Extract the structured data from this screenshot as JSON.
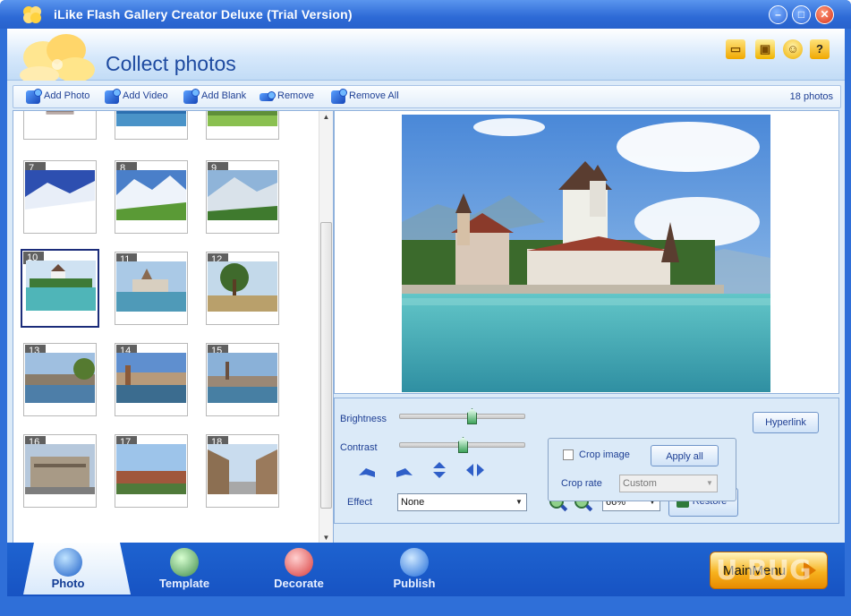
{
  "window": {
    "title": "iLike Flash Gallery Creator Deluxe (Trial Version)",
    "min_icon": "minimize-icon",
    "max_icon": "maximize-icon",
    "close_icon": "close-icon"
  },
  "header": {
    "page_title": "Collect photos",
    "icons": [
      "folder-icon",
      "save-icon",
      "user-icon",
      "help-icon"
    ]
  },
  "toolbar": {
    "add_photo": "Add Photo",
    "add_video": "Add Video",
    "add_blank": "Add Blank",
    "remove": "Remove",
    "remove_all": "Remove All",
    "photo_count": "18 photos"
  },
  "gallery": {
    "selected": "10",
    "thumbnails": [
      {
        "num": ""
      },
      {
        "num": ""
      },
      {
        "num": ""
      },
      {
        "num": "7"
      },
      {
        "num": "8"
      },
      {
        "num": "9"
      },
      {
        "num": "10"
      },
      {
        "num": "11"
      },
      {
        "num": "12"
      },
      {
        "num": "13"
      },
      {
        "num": "14"
      },
      {
        "num": "15"
      },
      {
        "num": "16"
      },
      {
        "num": "17"
      },
      {
        "num": "18"
      }
    ]
  },
  "controls": {
    "brightness_label": "Brightness",
    "brightness_value": 0.57,
    "contrast_label": "Contrast",
    "contrast_value": 0.5,
    "effect_label": "Effect",
    "effect_value": "None",
    "crop_image_label": "Crop image",
    "crop_image_checked": false,
    "apply_all": "Apply all",
    "crop_rate_label": "Crop rate",
    "crop_rate_value": "Custom",
    "hyperlink": "Hyperlink",
    "zoom_value": "66%",
    "restore": "Restore"
  },
  "bottom": {
    "tabs": [
      {
        "label": "Photo",
        "active": true
      },
      {
        "label": "Template",
        "active": false
      },
      {
        "label": "Decorate",
        "active": false
      },
      {
        "label": "Publish",
        "active": false
      }
    ],
    "main_menu": "MainMenu",
    "watermark": "U BUG"
  },
  "colors": {
    "accent": "#2f6fd8",
    "title_blue": "#1e4aa0",
    "panel": "#dbeaf8"
  }
}
